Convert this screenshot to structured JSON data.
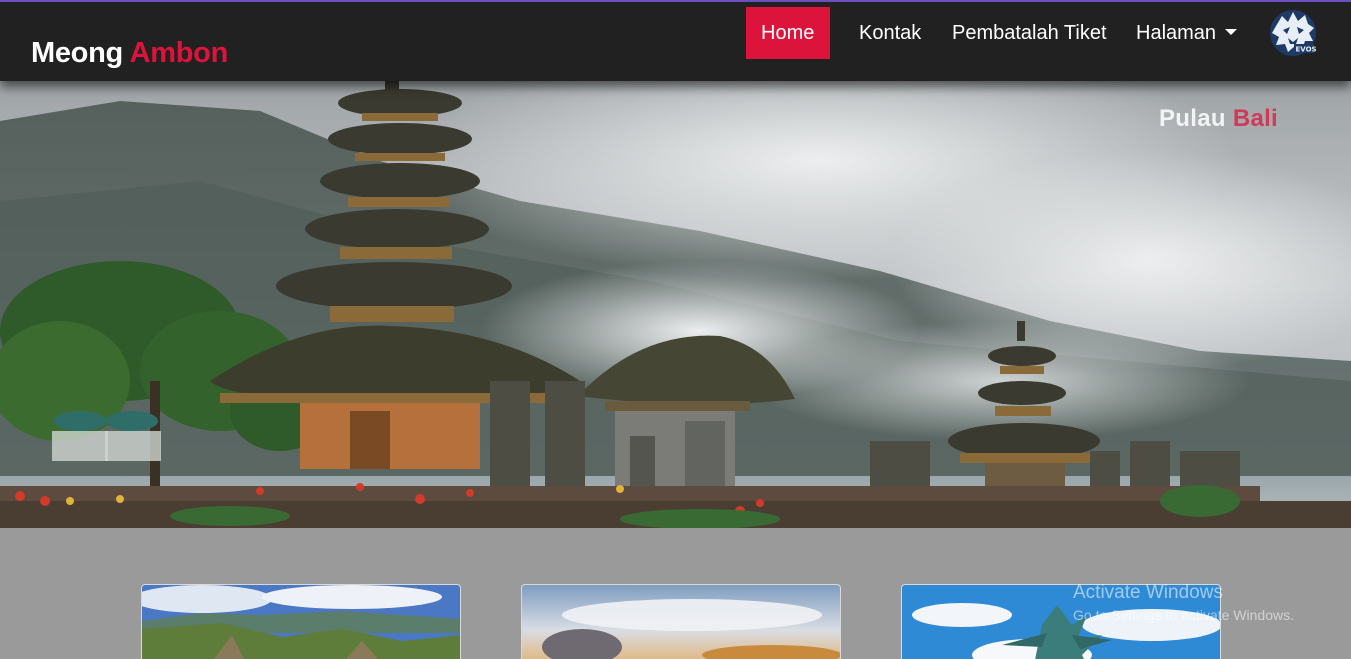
{
  "brand": {
    "first": "Meong",
    "second": "Ambon"
  },
  "nav": {
    "items": [
      {
        "label": "Home",
        "active": true
      },
      {
        "label": "Kontak",
        "active": false
      },
      {
        "label": "Pembatalah Tiket",
        "active": false
      },
      {
        "label": "Halaman",
        "active": false,
        "dropdown": true
      }
    ],
    "logo_icon": "lion-logo-icon"
  },
  "hero": {
    "title_first": "Pulau",
    "title_second": "Bali",
    "image": "bali-temple-lake-photo"
  },
  "cards": [
    {
      "image": "cliff-coast-photo"
    },
    {
      "image": "sunset-sky-photo"
    },
    {
      "image": "garuda-statue-photo"
    }
  ],
  "watermark": {
    "title": "Activate Windows",
    "subtitle": "Go to Settings to activate Windows."
  },
  "colors": {
    "accent": "#dc143c",
    "navbar": "#212121",
    "page_bg": "#9a9a9a"
  }
}
